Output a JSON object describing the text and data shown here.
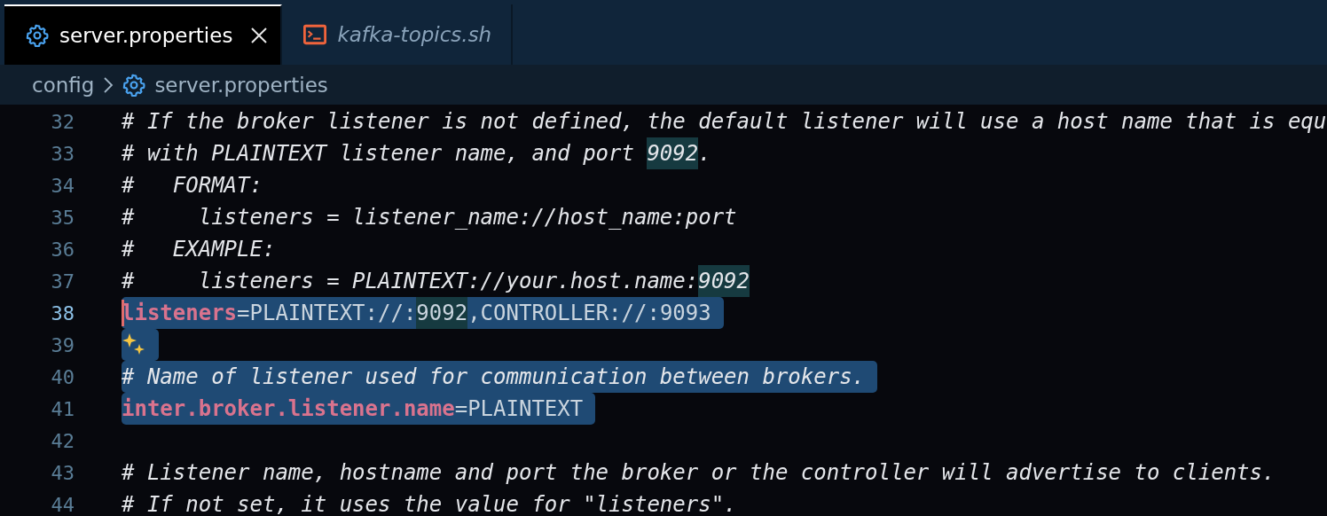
{
  "tabs": [
    {
      "label": "server.properties",
      "kind": "settings",
      "selected": true,
      "preview": false
    },
    {
      "label": "kafka-topics.sh",
      "kind": "shell",
      "selected": false,
      "preview": true
    }
  ],
  "breadcrumb": [
    {
      "label": "config",
      "kind": "folder"
    },
    {
      "label": "server.properties",
      "kind": "settings"
    }
  ],
  "lines": [
    {
      "number": "32",
      "kind": "code",
      "current": false,
      "selected": false,
      "tokens": [
        {
          "kind": "comment",
          "text": "# If the broker listener is not defined, the default listener will use a host name that is equ",
          "highlighted": false
        }
      ]
    },
    {
      "number": "33",
      "kind": "code",
      "current": false,
      "selected": false,
      "tokens": [
        {
          "kind": "comment",
          "text": "# with PLAINTEXT listener name, and port ",
          "highlighted": false
        },
        {
          "kind": "comment",
          "text": "9092",
          "highlighted": true
        },
        {
          "kind": "comment",
          "text": ".",
          "highlighted": false
        }
      ]
    },
    {
      "number": "34",
      "kind": "code",
      "current": false,
      "selected": false,
      "tokens": [
        {
          "kind": "comment",
          "text": "#   FORMAT:",
          "highlighted": false
        }
      ]
    },
    {
      "number": "35",
      "kind": "code",
      "current": false,
      "selected": false,
      "tokens": [
        {
          "kind": "comment",
          "text": "#     listeners = listener_name://host_name:port",
          "highlighted": false
        }
      ]
    },
    {
      "number": "36",
      "kind": "code",
      "current": false,
      "selected": false,
      "tokens": [
        {
          "kind": "comment",
          "text": "#   EXAMPLE:",
          "highlighted": false
        }
      ]
    },
    {
      "number": "37",
      "kind": "code",
      "current": false,
      "selected": false,
      "tokens": [
        {
          "kind": "comment",
          "text": "#     listeners = PLAINTEXT://your.host.name:",
          "highlighted": false
        },
        {
          "kind": "comment",
          "text": "9092",
          "highlighted": true
        }
      ]
    },
    {
      "number": "38",
      "kind": "code",
      "current": true,
      "selected": true,
      "tokens": [
        {
          "kind": "key",
          "text": "listeners",
          "highlighted": false
        },
        {
          "kind": "value",
          "text": "=PLAINTEXT://:",
          "highlighted": false
        },
        {
          "kind": "value",
          "text": "9092",
          "highlighted": true
        },
        {
          "kind": "value",
          "text": ",CONTROLLER://:9093",
          "highlighted": false
        }
      ]
    },
    {
      "number": "39",
      "kind": "suggestion",
      "current": false,
      "selected": true
    },
    {
      "number": "40",
      "kind": "code",
      "current": false,
      "selected": true,
      "tokens": [
        {
          "kind": "comment",
          "text": "# Name of listener used for communication between brokers.",
          "highlighted": false
        }
      ]
    },
    {
      "number": "41",
      "kind": "code",
      "current": false,
      "selected": true,
      "tokens": [
        {
          "kind": "key",
          "text": "inter.broker.listener.name",
          "highlighted": false
        },
        {
          "kind": "value",
          "text": "=PLAINTEXT",
          "highlighted": false
        }
      ]
    },
    {
      "number": "42",
      "kind": "code",
      "current": false,
      "selected": false
    },
    {
      "number": "43",
      "kind": "code",
      "current": false,
      "selected": false,
      "tokens": [
        {
          "kind": "comment",
          "text": "# Listener name, hostname and port the broker or the controller will advertise to clients.",
          "highlighted": false
        }
      ]
    },
    {
      "number": "44",
      "kind": "code",
      "current": false,
      "selected": false,
      "tokens": [
        {
          "kind": "comment",
          "text": "# If not set, it uses the value for \"listeners\".",
          "highlighted": false
        }
      ]
    }
  ]
}
